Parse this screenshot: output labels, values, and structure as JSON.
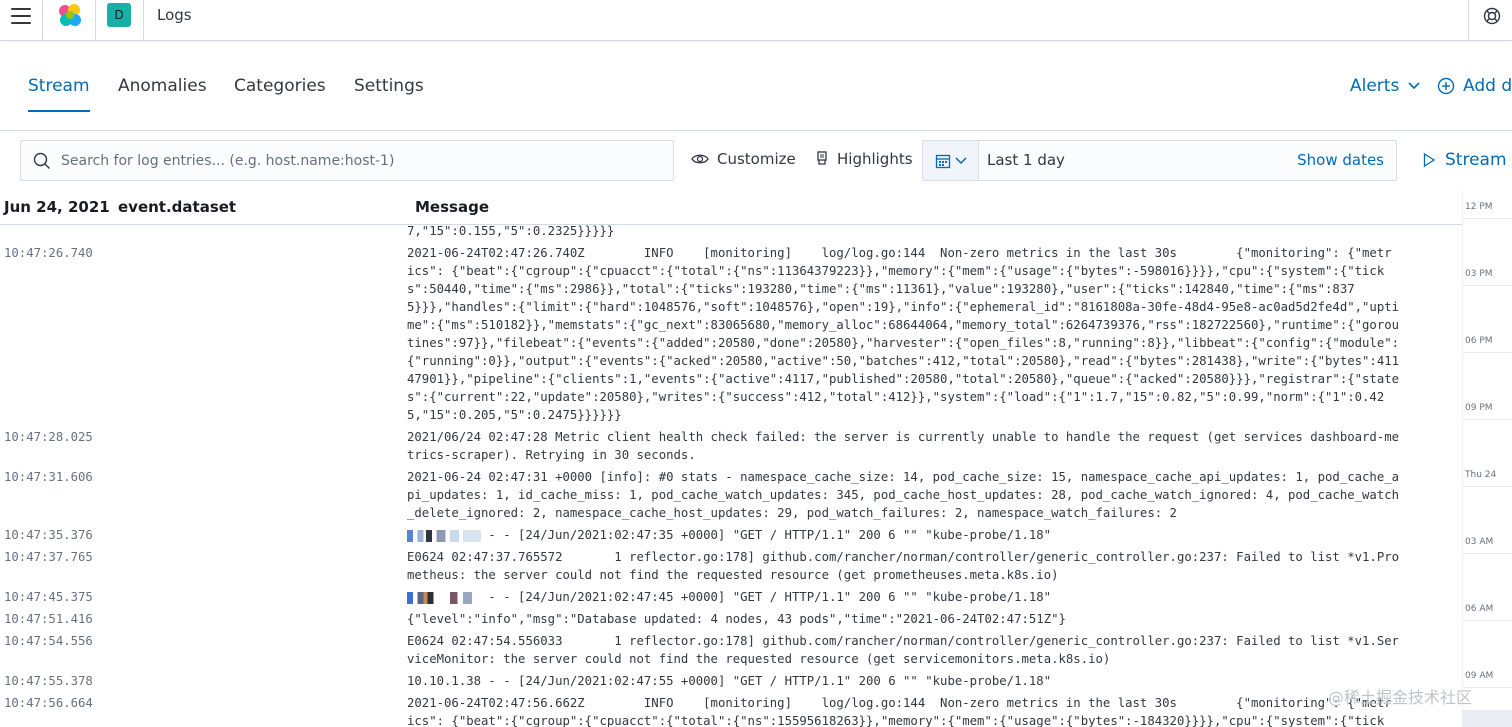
{
  "header": {
    "breadcrumb": "Logs",
    "space_initial": "D",
    "icons": [
      "menu-icon",
      "elastic-logo",
      "help-icon"
    ]
  },
  "tabs": [
    {
      "label": "Stream",
      "active": true
    },
    {
      "label": "Anomalies",
      "active": false
    },
    {
      "label": "Categories",
      "active": false
    },
    {
      "label": "Settings",
      "active": false
    }
  ],
  "header_actions": {
    "alerts": "Alerts",
    "add_data": "Add da"
  },
  "toolbar": {
    "search_placeholder": "Search for log entries... (e.g. host.name:host-1)",
    "customize": "Customize",
    "highlights": "Highlights",
    "time_range": "Last 1 day",
    "show_dates": "Show dates",
    "stream_live": "Stream li"
  },
  "columns": {
    "timestamp": "Jun 24, 2021",
    "dataset": "event.dataset",
    "message": "Message"
  },
  "log_entries": [
    {
      "time": "",
      "lines": [
        "7,\"15\":0.155,\"5\":0.2325}}}}}"
      ]
    },
    {
      "time": "10:47:26.740",
      "lines": [
        "2021-06-24T02:47:26.740Z        INFO    [monitoring]    log/log.go:144  Non-zero metrics in the last 30s        {\"monitoring\": {\"metr",
        "ics\": {\"beat\":{\"cgroup\":{\"cpuacct\":{\"total\":{\"ns\":11364379223}},\"memory\":{\"mem\":{\"usage\":{\"bytes\":-598016}}}},\"cpu\":{\"system\":{\"tick",
        "s\":50440,\"time\":{\"ms\":2986}},\"total\":{\"ticks\":193280,\"time\":{\"ms\":11361},\"value\":193280},\"user\":{\"ticks\":142840,\"time\":{\"ms\":837",
        "5}}},\"handles\":{\"limit\":{\"hard\":1048576,\"soft\":1048576},\"open\":19},\"info\":{\"ephemeral_id\":\"8161808a-30fe-48d4-95e8-ac0ad5d2fe4d\",\"upti",
        "me\":{\"ms\":510182}},\"memstats\":{\"gc_next\":83065680,\"memory_alloc\":68644064,\"memory_total\":6264739376,\"rss\":182722560},\"runtime\":{\"gorou",
        "tines\":97}},\"filebeat\":{\"events\":{\"added\":20580,\"done\":20580},\"harvester\":{\"open_files\":8,\"running\":8}},\"libbeat\":{\"config\":{\"module\":",
        "{\"running\":0}},\"output\":{\"events\":{\"acked\":20580,\"active\":50,\"batches\":412,\"total\":20580},\"read\":{\"bytes\":281438},\"write\":{\"bytes\":411",
        "47901}},\"pipeline\":{\"clients\":1,\"events\":{\"active\":4117,\"published\":20580,\"total\":20580},\"queue\":{\"acked\":20580}}},\"registrar\":{\"state",
        "s\":{\"current\":22,\"update\":20580},\"writes\":{\"success\":412,\"total\":412}},\"system\":{\"load\":{\"1\":1.7,\"15\":0.82,\"5\":0.99,\"norm\":{\"1\":0.42",
        "5,\"15\":0.205,\"5\":0.2475}}}}}}"
      ]
    },
    {
      "time": "10:47:28.025",
      "lines": [
        "2021/06/24 02:47:28 Metric client health check failed: the server is currently unable to handle the request (get services dashboard-me",
        "trics-scraper). Retrying in 30 seconds."
      ]
    },
    {
      "time": "10:47:31.606",
      "lines": [
        "2021-06-24 02:47:31 +0000 [info]: #0 stats - namespace_cache_size: 14, pod_cache_size: 15, namespace_cache_api_updates: 1, pod_cache_a",
        "pi_updates: 1, id_cache_miss: 1, pod_cache_watch_updates: 345, pod_cache_host_updates: 28, pod_cache_watch_ignored: 4, pod_cache_watch",
        "_delete_ignored: 2, namespace_cache_host_updates: 29, pod_watch_failures: 2, namespace_watch_failures: 2"
      ]
    },
    {
      "time": "10:47:35.376",
      "redacted": 1,
      "lines": [
        " - - [24/Jun/2021:02:47:35 +0000] \"GET / HTTP/1.1\" 200 6 \"\" \"kube-probe/1.18\""
      ]
    },
    {
      "time": "10:47:37.765",
      "lines": [
        "E0624 02:47:37.765572       1 reflector.go:178] github.com/rancher/norman/controller/generic_controller.go:237: Failed to list *v1.Pro",
        "metheus: the server could not find the requested resource (get prometheuses.meta.k8s.io)"
      ]
    },
    {
      "time": "10:47:45.375",
      "redacted": 2,
      "lines": [
        " - - [24/Jun/2021:02:47:45 +0000] \"GET / HTTP/1.1\" 200 6 \"\" \"kube-probe/1.18\""
      ]
    },
    {
      "time": "10:47:51.416",
      "lines": [
        "{\"level\":\"info\",\"msg\":\"Database updated: 4 nodes, 43 pods\",\"time\":\"2021-06-24T02:47:51Z\"}"
      ]
    },
    {
      "time": "10:47:54.556",
      "lines": [
        "E0624 02:47:54.556033       1 reflector.go:178] github.com/rancher/norman/controller/generic_controller.go:237: Failed to list *v1.Ser",
        "viceMonitor: the server could not find the requested resource (get servicemonitors.meta.k8s.io)"
      ]
    },
    {
      "time": "10:47:55.378",
      "lines": [
        "10.10.1.38 - - [24/Jun/2021:02:47:55 +0000] \"GET / HTTP/1.1\" 200 6 \"\" \"kube-probe/1.18\""
      ]
    },
    {
      "time": "10:47:56.664",
      "lines": [
        "2021-06-24T02:47:56.662Z        INFO    [monitoring]    log/log.go:144  Non-zero metrics in the last 30s        {\"monitoring\": {\"metr",
        "ics\": {\"beat\":{\"cgroup\":{\"cpuacct\":{\"total\":{\"ns\":15595618263}},\"memory\":{\"mem\":{\"usage\":{\"bytes\":-184320}}}},\"cpu\":{\"system\":{\"tick"
      ]
    }
  ],
  "ruler_ticks": [
    "12 PM",
    "03 PM",
    "06 PM",
    "09 PM",
    "Thu 24",
    "03 AM",
    "06 AM",
    "09 AM"
  ],
  "watermark": "@稀土掘金技术社区"
}
